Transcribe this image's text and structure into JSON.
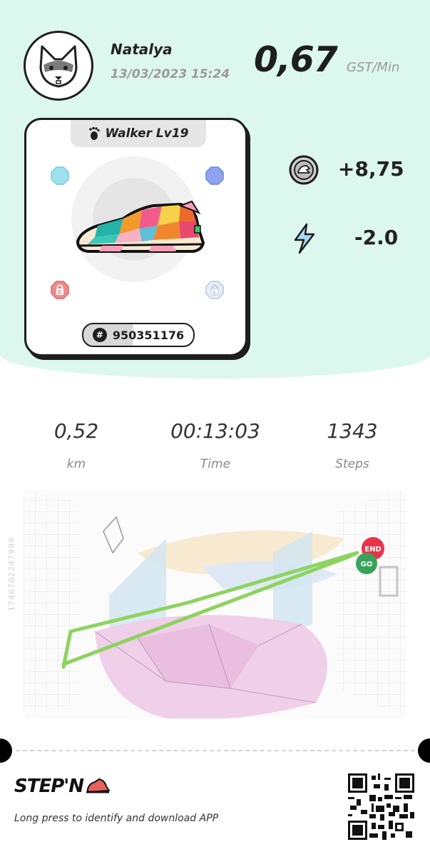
{
  "user": {
    "name": "Natalya",
    "datetime": "13/03/2023 15:24"
  },
  "earnings": {
    "rate": "0,67",
    "rate_unit": "GST/Min",
    "gst": "+8,75",
    "energy": "-2.0"
  },
  "sneaker": {
    "level_label": "Walker Lv19",
    "id": "950351176",
    "lock_left": "C",
    "lock_right": "L"
  },
  "stats": [
    {
      "value": "0,52",
      "label": "km"
    },
    {
      "value": "00:13:03",
      "label": "Time"
    },
    {
      "value": "1343",
      "label": "Steps"
    }
  ],
  "map": {
    "side_code": "1746702247999",
    "end_label": "END",
    "go_label": "GO"
  },
  "footer": {
    "brand": "STEP'N",
    "tagline": "Long press to identify and download APP"
  },
  "icons": [
    "avatar-fox-icon",
    "footprint-icon",
    "gst-coin-icon",
    "energy-bolt-icon",
    "lock-icon",
    "qr-code"
  ],
  "colors": {
    "header_bg": "#dcf7ee",
    "route": "#8ed35f",
    "end": "#e8334a",
    "go": "#3aa35b"
  }
}
